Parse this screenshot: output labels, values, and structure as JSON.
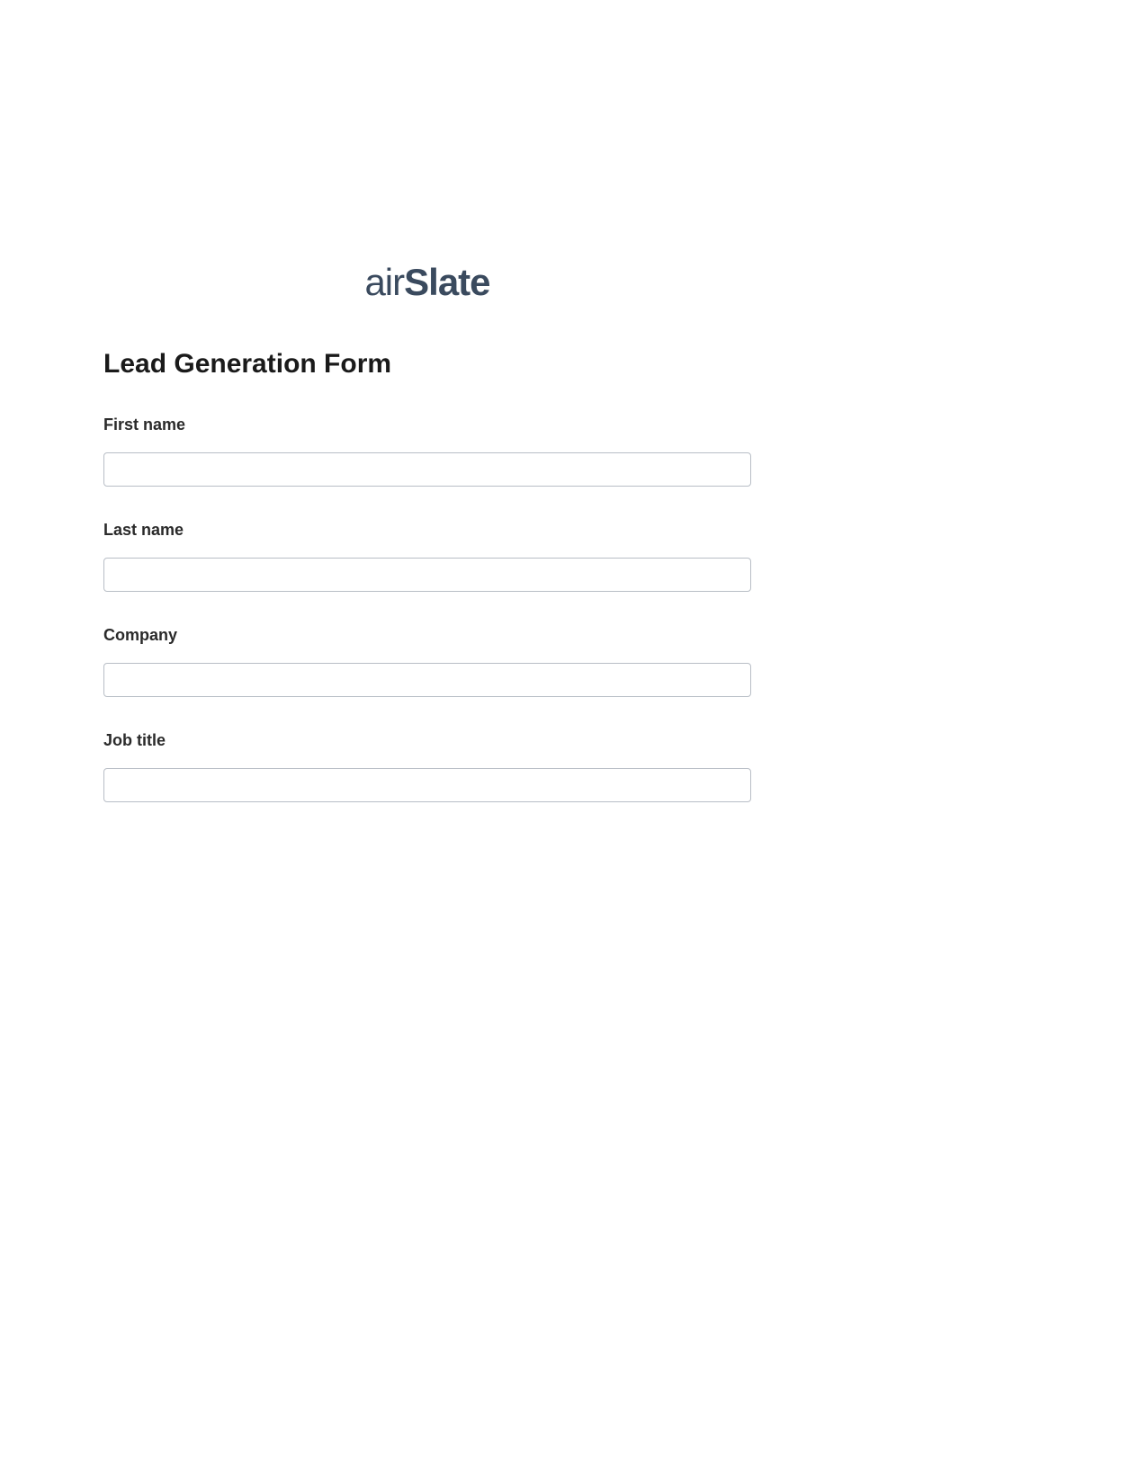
{
  "logo": {
    "prefix": "air",
    "suffix": "Slate"
  },
  "form": {
    "title": "Lead Generation Form",
    "fields": [
      {
        "label": "First name",
        "value": ""
      },
      {
        "label": "Last name",
        "value": ""
      },
      {
        "label": "Company",
        "value": ""
      },
      {
        "label": "Job title",
        "value": ""
      }
    ]
  }
}
